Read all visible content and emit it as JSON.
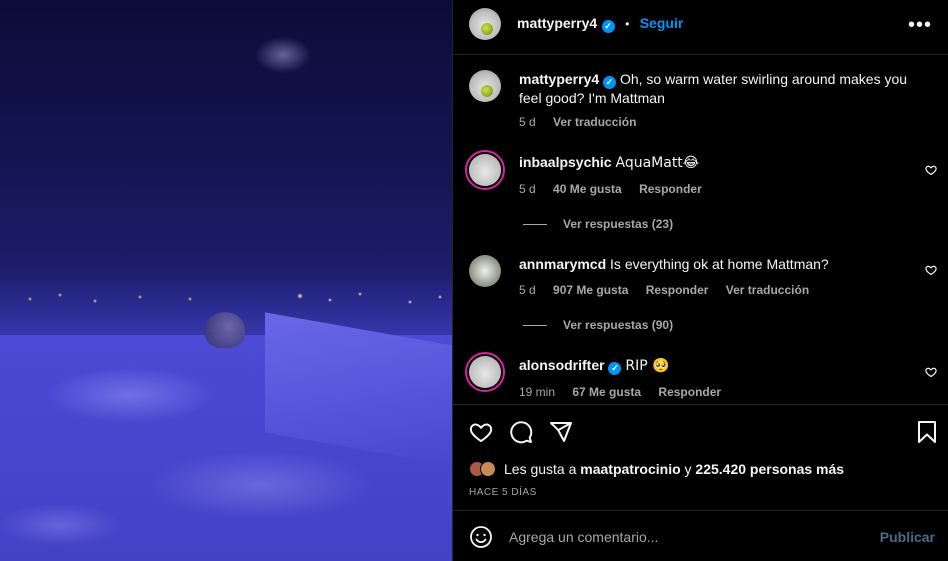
{
  "header": {
    "username": "mattyperry4",
    "separator": "•",
    "follow_label": "Seguir",
    "more_icon": "more-horizontal-icon"
  },
  "caption": {
    "username": "mattyperry4",
    "text": "Oh, so warm water swirling around makes you feel good? I'm Mattman",
    "time": "5 d",
    "translate": "Ver traducción"
  },
  "comments": [
    {
      "username": "inbaalpsychic",
      "text": "AquaMatt😂",
      "time": "5 d",
      "likes": "40 Me gusta",
      "reply": "Responder",
      "view_replies": "Ver respuestas (23)"
    },
    {
      "username": "annmarymcd",
      "text": "Is everything ok at home Mattman?",
      "time": "5 d",
      "likes": "907 Me gusta",
      "reply": "Responder",
      "translate": "Ver traducción",
      "view_replies": "Ver respuestas (90)"
    },
    {
      "username": "alonsodrifter",
      "text": "RIP 🥺",
      "time": "19 min",
      "likes": "67 Me gusta",
      "reply": "Responder"
    }
  ],
  "actions": {
    "likes_prefix": "Les gusta a",
    "liked_by": "maatpatrocinio",
    "conj": "y",
    "others": "225.420 personas más",
    "posted": "HACE 5 DÍAS"
  },
  "composer": {
    "placeholder": "Agrega un comentario...",
    "publish": "Publicar"
  },
  "colors": {
    "accent": "#0095f6",
    "background": "#000000",
    "secondary_text": "#a8a8a8"
  }
}
